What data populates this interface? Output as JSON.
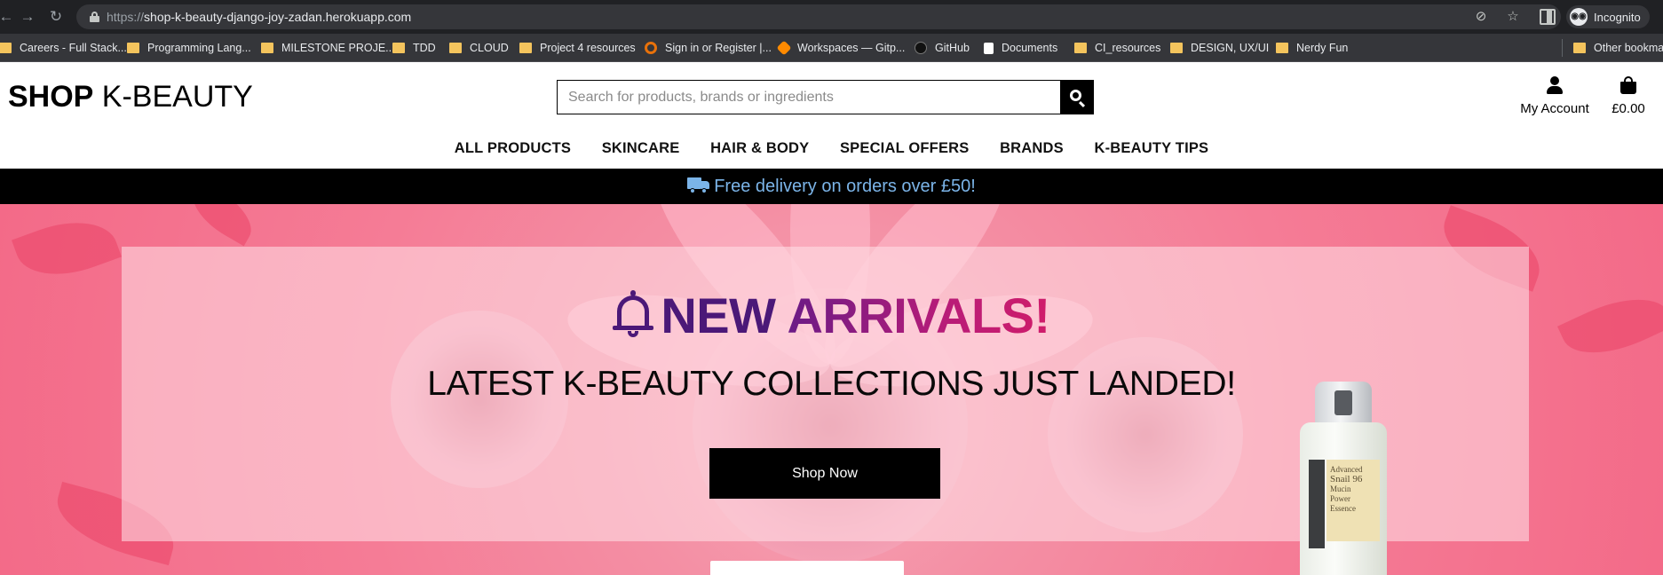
{
  "browser": {
    "url_scheme": "https://",
    "url_host": "shop-k-beauty-django-joy-zadan.herokuapp.com",
    "profile_label": "Incognito",
    "bookmarks": [
      {
        "label": "Careers - Full Stack...",
        "icon": "folder-icon"
      },
      {
        "label": "Programming Lang...",
        "icon": "folder-icon"
      },
      {
        "label": "MILESTONE PROJE...",
        "icon": "folder-icon"
      },
      {
        "label": "TDD",
        "icon": "folder-icon"
      },
      {
        "label": "CLOUD",
        "icon": "folder-icon"
      },
      {
        "label": "Project 4 resources",
        "icon": "folder-icon"
      },
      {
        "label": "Sign in or Register |...",
        "icon": "site-icon"
      },
      {
        "label": "Workspaces — Gitp...",
        "icon": "gitpod-icon"
      },
      {
        "label": "GitHub",
        "icon": "github-icon"
      },
      {
        "label": "Documents",
        "icon": "notion-icon"
      },
      {
        "label": "CI_resources",
        "icon": "folder-icon"
      },
      {
        "label": "DESIGN, UX/UI",
        "icon": "folder-icon"
      },
      {
        "label": "Nerdy Fun",
        "icon": "folder-icon"
      },
      {
        "label": "Other bookmarks",
        "icon": "folder-icon"
      }
    ]
  },
  "header": {
    "logo_bold": "SHOP",
    "logo_rest": " K-BEAUTY",
    "search_placeholder": "Search for products, brands or ingredients",
    "account_label": "My Account",
    "bag_total": "£0.00"
  },
  "nav": {
    "items": [
      "ALL PRODUCTS",
      "SKINCARE",
      "HAIR & BODY",
      "SPECIAL OFFERS",
      "BRANDS",
      "K-BEAUTY TIPS"
    ]
  },
  "banner": {
    "text": "Free delivery on orders over £50!",
    "color": "#7bb4e8"
  },
  "hero": {
    "title_new": "NEW",
    "title_arrivals": "ARRIVALS!",
    "subtitle": "LATEST K-BEAUTY COLLECTIONS JUST LANDED!",
    "cta_label": "Shop Now",
    "product_label": [
      "Advanced",
      "Snail 96",
      "Mucin",
      "Power",
      "Essence"
    ]
  },
  "colors": {
    "accent_purple": "#4b1878",
    "accent_magenta": "#d01c6a",
    "hero_pink": "#f57c96"
  }
}
